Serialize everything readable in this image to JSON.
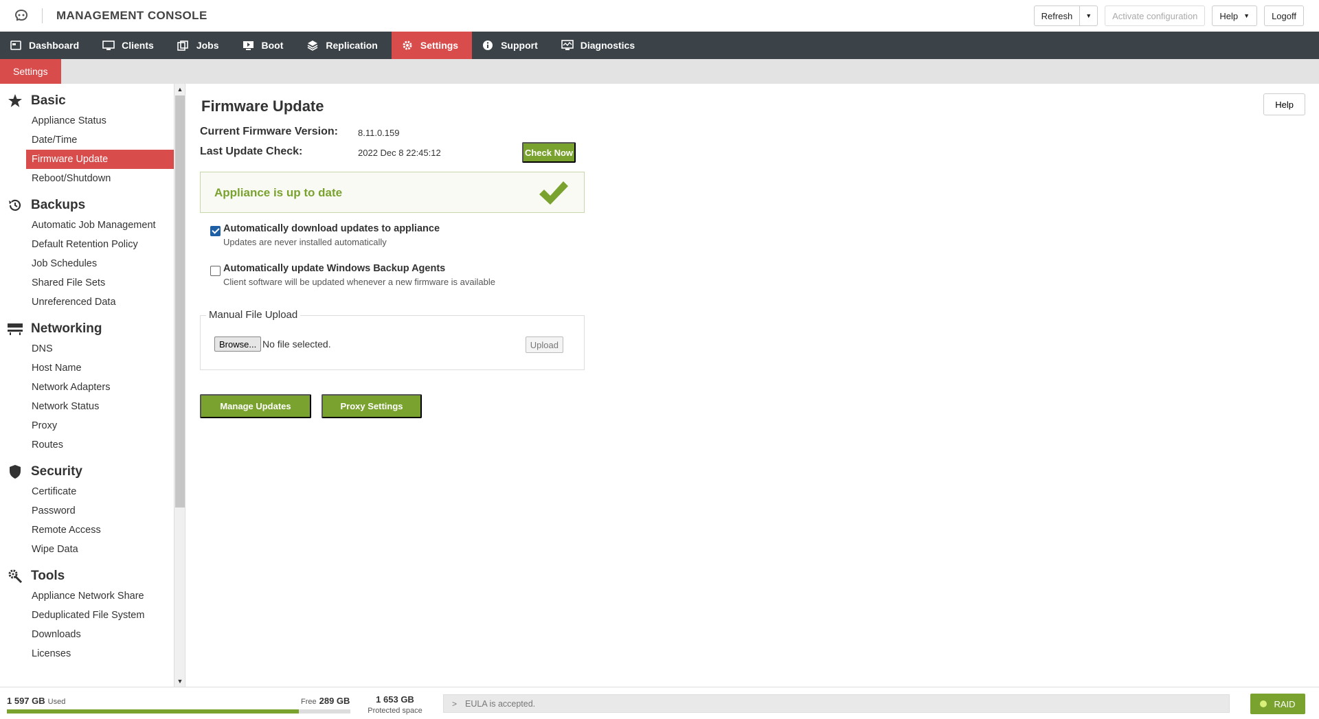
{
  "app": {
    "title": "MANAGEMENT CONSOLE"
  },
  "top_actions": {
    "refresh": "Refresh",
    "activate": "Activate configuration",
    "help": "Help",
    "logoff": "Logoff"
  },
  "nav": {
    "items": [
      {
        "label": "Dashboard",
        "icon": "dashboard-icon"
      },
      {
        "label": "Clients",
        "icon": "monitor-icon"
      },
      {
        "label": "Jobs",
        "icon": "jobs-icon"
      },
      {
        "label": "Boot",
        "icon": "boot-icon"
      },
      {
        "label": "Replication",
        "icon": "replication-icon"
      },
      {
        "label": "Settings",
        "icon": "gear-icon",
        "active": true
      },
      {
        "label": "Support",
        "icon": "info-icon"
      },
      {
        "label": "Diagnostics",
        "icon": "diagnostics-icon"
      }
    ]
  },
  "breadcrumb": {
    "label": "Settings"
  },
  "sidebar": {
    "sections": [
      {
        "title": "Basic",
        "icon": "star-icon",
        "items": [
          "Appliance Status",
          "Date/Time",
          "Firmware Update",
          "Reboot/Shutdown"
        ]
      },
      {
        "title": "Backups",
        "icon": "history-icon",
        "items": [
          "Automatic Job Management",
          "Default Retention Policy",
          "Job Schedules",
          "Shared File Sets",
          "Unreferenced Data"
        ]
      },
      {
        "title": "Networking",
        "icon": "network-icon",
        "items": [
          "DNS",
          "Host Name",
          "Network Adapters",
          "Network Status",
          "Proxy",
          "Routes"
        ]
      },
      {
        "title": "Security",
        "icon": "shield-icon",
        "items": [
          "Certificate",
          "Password",
          "Remote Access",
          "Wipe Data"
        ]
      },
      {
        "title": "Tools",
        "icon": "tools-icon",
        "items": [
          "Appliance Network Share",
          "Deduplicated File System",
          "Downloads",
          "Licenses"
        ]
      }
    ],
    "active_item": "Firmware Update"
  },
  "main": {
    "title": "Firmware Update",
    "help": "Help",
    "current_version_label": "Current Firmware Version:",
    "current_version_value": "8.11.0.159",
    "last_check_label": "Last Update Check:",
    "last_check_value": "2022 Dec 8 22:45:12",
    "check_now": "Check Now",
    "status": "Appliance is up to date",
    "auto_download": {
      "label": "Automatically download updates to appliance",
      "sub": "Updates are never installed automatically",
      "checked": true
    },
    "auto_agents": {
      "label": "Automatically update Windows Backup Agents",
      "sub": "Client software will be updated whenever a new firmware is available",
      "checked": false
    },
    "manual_upload": {
      "legend": "Manual File Upload",
      "browse": "Browse...",
      "no_file": "No file selected.",
      "upload": "Upload"
    },
    "manage_updates": "Manage Updates",
    "proxy_settings": "Proxy Settings"
  },
  "footer": {
    "used_value": "1 597 GB",
    "used_label": "Used",
    "free_label": "Free",
    "free_value": "289 GB",
    "used_fraction": 0.85,
    "protected_value": "1 653 GB",
    "protected_label": "Protected space",
    "eula": "EULA is accepted.",
    "raid": "RAID"
  },
  "colors": {
    "accent_red": "#d94c4c",
    "accent_green": "#7aa22f",
    "nav_bg": "#3b4348",
    "checkbox_blue": "#1e5fa6"
  }
}
